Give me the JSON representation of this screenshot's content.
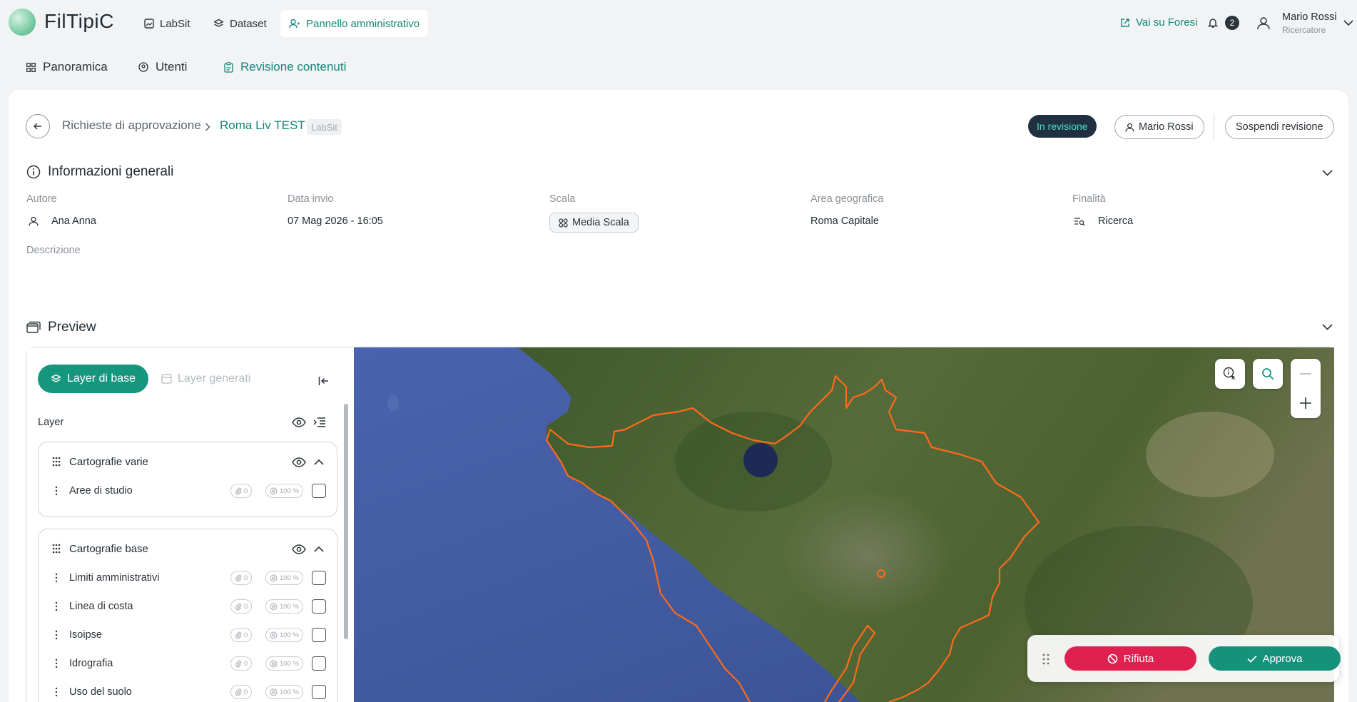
{
  "app": {
    "name": "FilTipiC"
  },
  "topnav": [
    {
      "label": "LabSit",
      "icon": "image-icon"
    },
    {
      "label": "Dataset",
      "icon": "layers-icon"
    },
    {
      "label": "Pannello amministrativo",
      "icon": "admin-icon"
    }
  ],
  "header_right": {
    "external_link": "Vai su Foresi",
    "notification_count": "2",
    "user_name": "Mario Rossi",
    "user_role": "Ricercatore"
  },
  "subnav": [
    {
      "label": "Panoramica",
      "icon": "grid-icon"
    },
    {
      "label": "Utenti",
      "icon": "users-icon"
    },
    {
      "label": "Revisione contenuti",
      "icon": "clipboard-icon"
    }
  ],
  "breadcrumb": {
    "parent": "Richieste di approvazione",
    "current": "Roma Liv TEST",
    "tag": "LabSit"
  },
  "status": {
    "badge": "In revisione",
    "reviewer": "Mario Rossi",
    "suspend_button": "Sospendi revisione"
  },
  "general_info": {
    "title": "Informazioni generali",
    "fields": {
      "author_label": "Autore",
      "author": "Ana Anna",
      "date_label": "Data invio",
      "date": "07 Mag 2026 - 16:05",
      "scale_label": "Scala",
      "scale": "Media Scala",
      "area_label": "Area geografica",
      "area": "Roma Capitale",
      "purpose_label": "Finalità",
      "purpose": "Ricerca",
      "description_label": "Descrizione"
    }
  },
  "preview": {
    "title": "Preview",
    "tabs": {
      "active": "Layer di base",
      "inactive": "Layer generati"
    },
    "layer_header": "Layer",
    "groups": [
      {
        "title": "Cartografie varie",
        "rows": [
          {
            "label": "Aree di studio",
            "count": "0",
            "opacity": "100 %"
          }
        ]
      },
      {
        "title": "Cartografie base",
        "rows": [
          {
            "label": "Limiti amministrativi",
            "count": "0",
            "opacity": "100 %"
          },
          {
            "label": "Linea di costa",
            "count": "0",
            "opacity": "100 %"
          },
          {
            "label": "Isoipse",
            "count": "0",
            "opacity": "100 %"
          },
          {
            "label": "Idrografia",
            "count": "0",
            "opacity": "100 %"
          },
          {
            "label": "Uso del suolo",
            "count": "0",
            "opacity": "100 %"
          }
        ]
      }
    ]
  },
  "actions": {
    "reject": "Rifiuta",
    "approve": "Approva"
  },
  "colors": {
    "accent": "#16967f",
    "reject": "#e0204e",
    "boundary": "#ff6a1a",
    "sea": "#3f57a3"
  }
}
